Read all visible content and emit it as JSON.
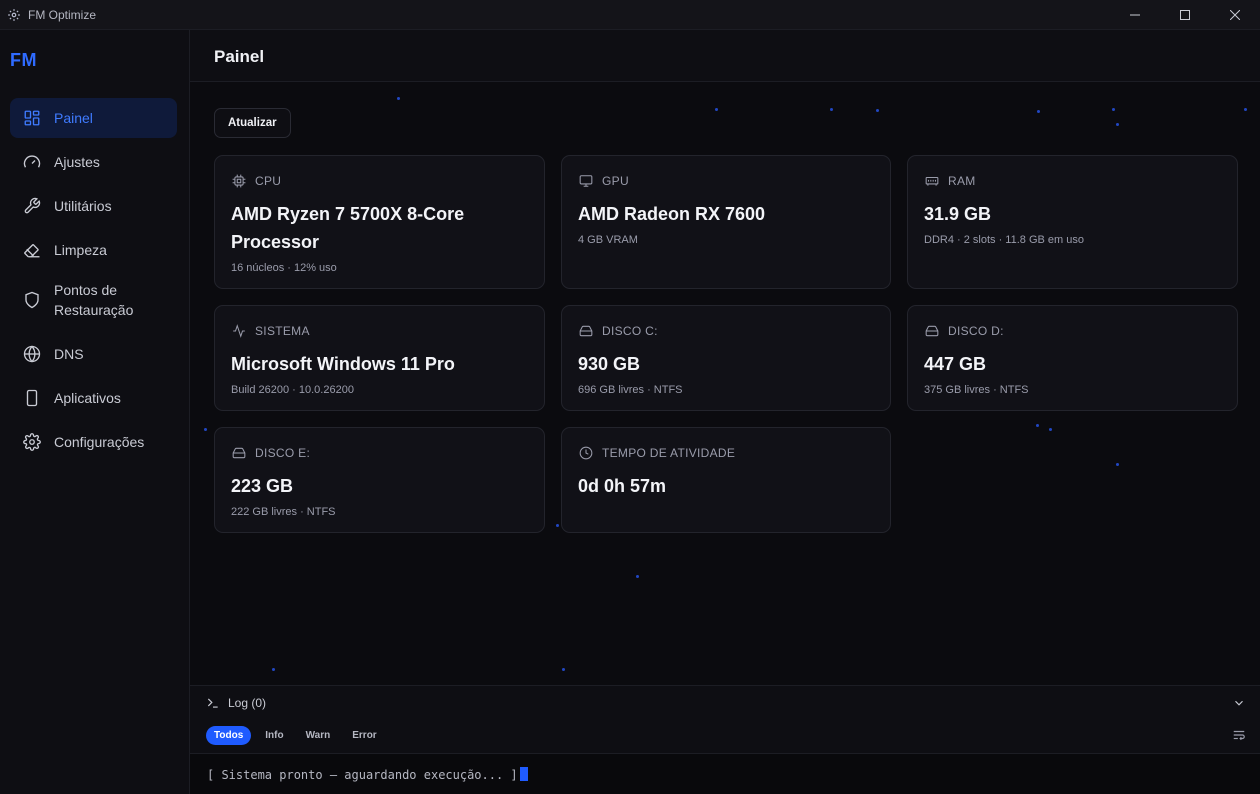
{
  "window": {
    "title": "FM Optimize"
  },
  "sidebar": {
    "brand": "FM",
    "items": [
      {
        "label": "Painel",
        "icon": "dashboard-icon",
        "active": true
      },
      {
        "label": "Ajustes",
        "icon": "gauge-icon"
      },
      {
        "label": "Utilitários",
        "icon": "wrench-icon"
      },
      {
        "label": "Limpeza",
        "icon": "eraser-icon"
      },
      {
        "label": "Pontos de Restauração",
        "icon": "shield-icon"
      },
      {
        "label": "DNS",
        "icon": "globe-icon"
      },
      {
        "label": "Aplicativos",
        "icon": "smartphone-icon"
      },
      {
        "label": "Configurações",
        "icon": "gear-icon"
      }
    ]
  },
  "header": {
    "title": "Painel"
  },
  "toolbar": {
    "refresh_label": "Atualizar"
  },
  "cards": {
    "cpu": {
      "label": "CPU",
      "value": "AMD Ryzen 7 5700X 8-Core Processor",
      "sub": "16 núcleos · 12% uso"
    },
    "gpu": {
      "label": "GPU",
      "value": "AMD Radeon RX 7600",
      "sub": "4 GB VRAM"
    },
    "ram": {
      "label": "RAM",
      "value": "31.9 GB",
      "sub": "DDR4 · 2 slots · 11.8 GB em uso"
    },
    "sistema": {
      "label": "SISTEMA",
      "value": "Microsoft Windows 11 Pro",
      "sub": "Build 26200 · 10.0.26200"
    },
    "disco_c": {
      "label": "DISCO C:",
      "value": "930 GB",
      "sub": "696 GB livres · NTFS"
    },
    "disco_d": {
      "label": "DISCO D:",
      "value": "447 GB",
      "sub": "375 GB livres · NTFS"
    },
    "disco_e": {
      "label": "DISCO E:",
      "value": "223 GB",
      "sub": "222 GB livres · NTFS"
    },
    "uptime": {
      "label": "TEMPO DE ATIVIDADE",
      "value": "0d 0h 57m"
    }
  },
  "log": {
    "title": "Log (0)",
    "filters": [
      "Todos",
      "Info",
      "Warn",
      "Error"
    ],
    "active_filter": "Todos",
    "console_line": "[ Sistema pronto — aguardando execução... ]"
  },
  "colors": {
    "accent": "#1f5bff",
    "background": "#0b0b0f",
    "card": "#111117"
  }
}
